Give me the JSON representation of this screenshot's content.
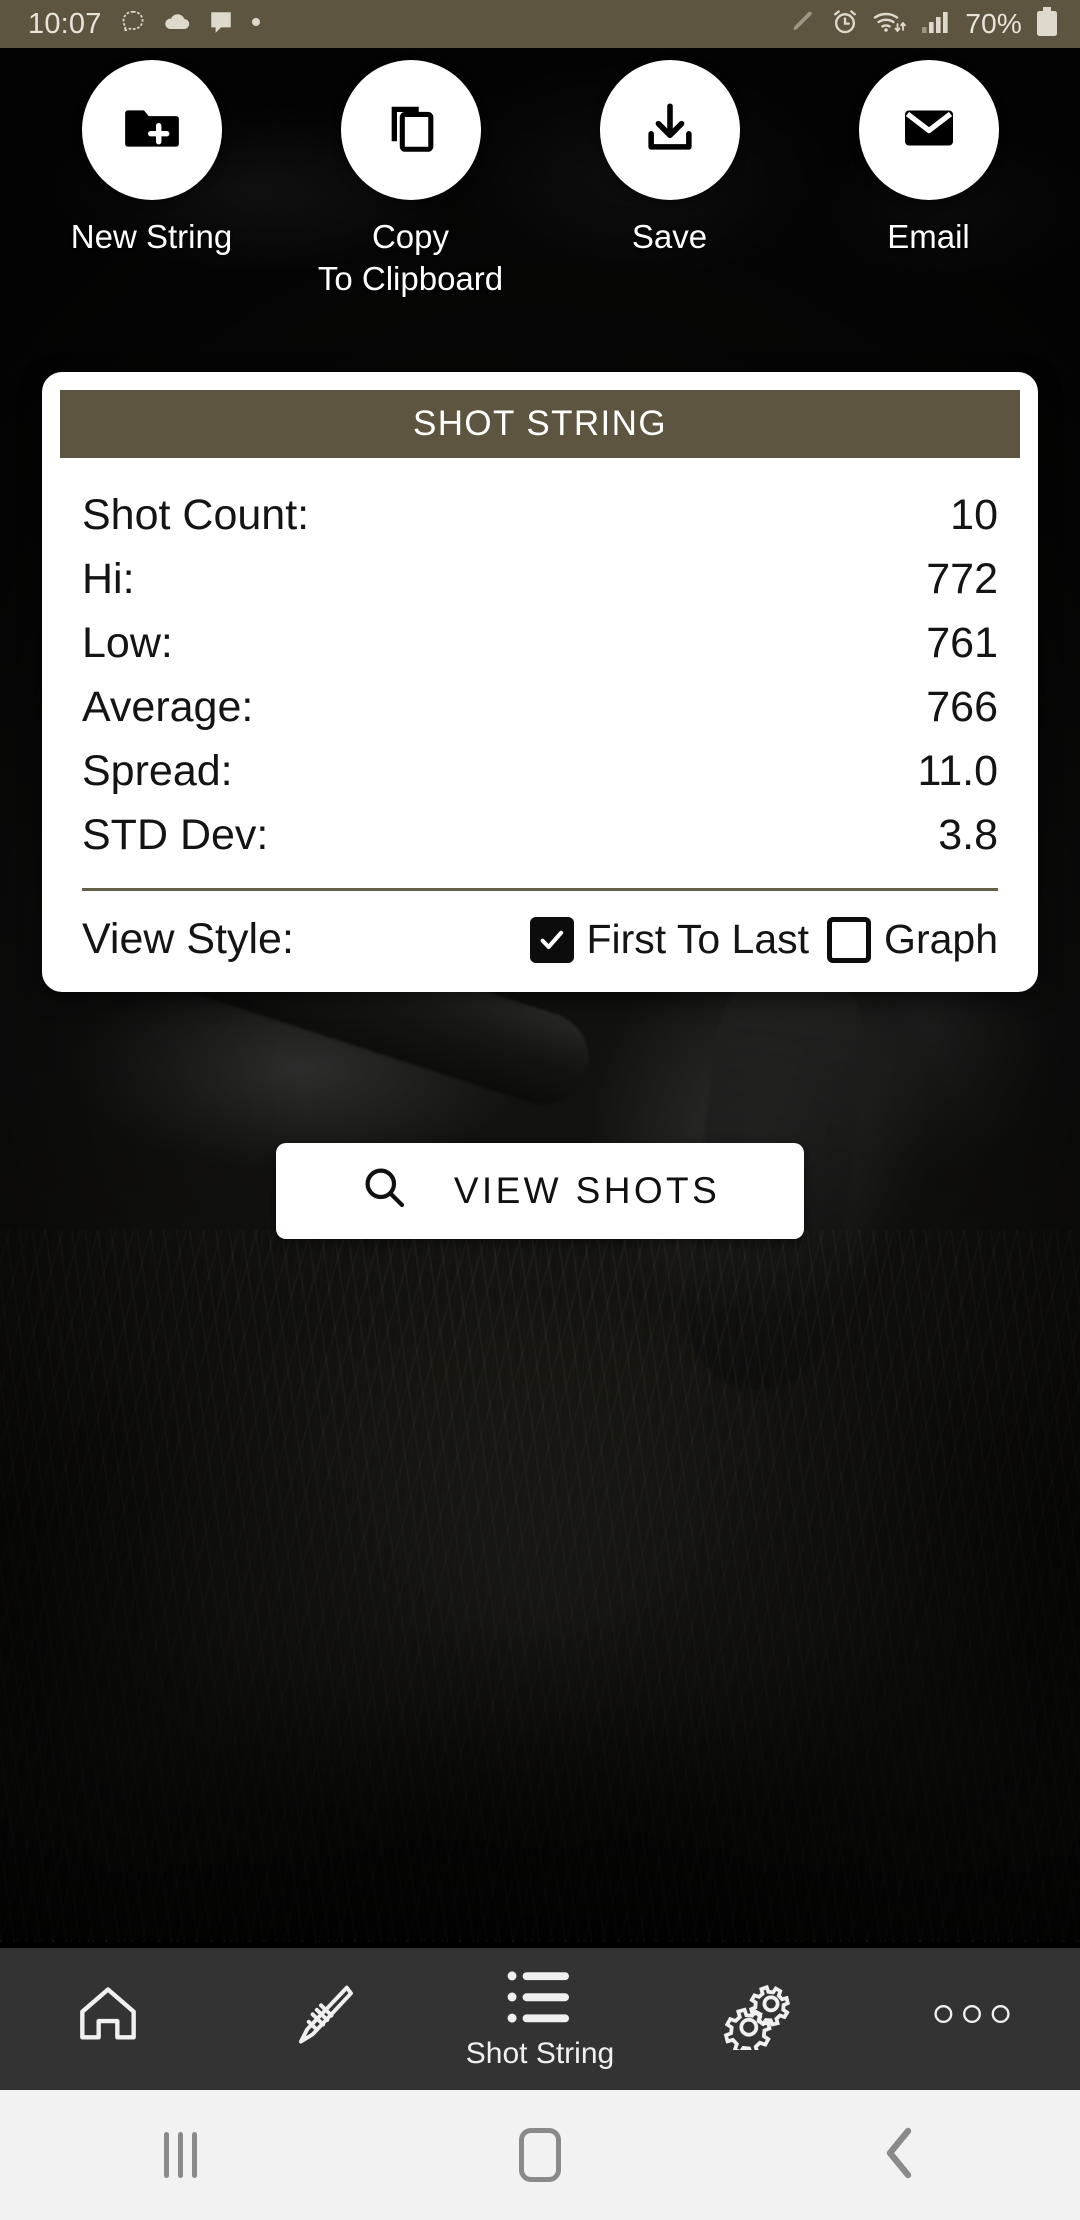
{
  "status_bar": {
    "time": "10:07",
    "left_icons": [
      "notification-bubble-icon",
      "cloud-icon",
      "message-icon",
      "dot-icon"
    ],
    "right_icons": [
      "pencil-icon",
      "alarm-icon",
      "wifi-icon",
      "signal-icon"
    ],
    "battery_text": "70%",
    "battery_icon": "battery-icon",
    "background_color": "#5d553f"
  },
  "actions": [
    {
      "id": "new-string",
      "label": "New String",
      "icon": "folder-plus-icon"
    },
    {
      "id": "copy-to-clipboard",
      "label": "Copy\nTo Clipboard",
      "icon": "copy-icon"
    },
    {
      "id": "save",
      "label": "Save",
      "icon": "download-icon"
    },
    {
      "id": "email",
      "label": "Email",
      "icon": "envelope-icon"
    }
  ],
  "card": {
    "header_title": "SHOT STRING",
    "header_color": "#5d553f",
    "stats": [
      {
        "label": "Shot Count:",
        "value": "10"
      },
      {
        "label": "Hi:",
        "value": "772"
      },
      {
        "label": "Low:",
        "value": "761"
      },
      {
        "label": "Average:",
        "value": "766"
      },
      {
        "label": "Spread:",
        "value": "11.0"
      },
      {
        "label": "STD Dev:",
        "value": "3.8"
      }
    ],
    "view_style": {
      "label": "View Style:",
      "options": [
        {
          "label": "First To Last",
          "checked": true
        },
        {
          "label": "Graph",
          "checked": false
        }
      ]
    }
  },
  "view_shots_button": {
    "label": "VIEW SHOTS",
    "icon": "search-icon"
  },
  "bottom_nav": {
    "items": [
      {
        "id": "home",
        "icon": "home-icon",
        "label": "",
        "active": false
      },
      {
        "id": "rifle",
        "icon": "rifle-icon",
        "label": "",
        "active": false
      },
      {
        "id": "shot-string",
        "icon": "list-icon",
        "label": "Shot String",
        "active": true
      },
      {
        "id": "settings",
        "icon": "gears-icon",
        "label": "",
        "active": false
      },
      {
        "id": "more",
        "icon": "more-dots-icon",
        "label": "",
        "active": false
      }
    ],
    "background_color": "#333333"
  },
  "system_nav": {
    "recents": "recents-icon",
    "home": "home-pill-icon",
    "back": "back-chevron-icon",
    "background_color": "#f2f2f2"
  }
}
